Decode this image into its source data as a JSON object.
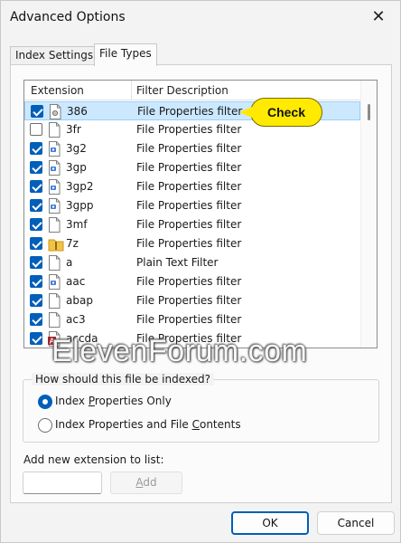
{
  "window": {
    "title": "Advanced Options"
  },
  "tabs": [
    {
      "label": "Index Settings",
      "selected": false
    },
    {
      "label": "File Types",
      "selected": true
    }
  ],
  "list": {
    "columns": [
      "Extension",
      "Filter Description"
    ],
    "rows": [
      {
        "ext": "386",
        "desc": "File Properties filter",
        "checked": true,
        "icon": "system-file-icon",
        "selected": true
      },
      {
        "ext": "3fr",
        "desc": "File Properties filter",
        "checked": false,
        "icon": "blank-file-icon"
      },
      {
        "ext": "3g2",
        "desc": "File Properties filter",
        "checked": true,
        "icon": "media-file-icon"
      },
      {
        "ext": "3gp",
        "desc": "File Properties filter",
        "checked": true,
        "icon": "media-file-icon"
      },
      {
        "ext": "3gp2",
        "desc": "File Properties filter",
        "checked": true,
        "icon": "media-file-icon"
      },
      {
        "ext": "3gpp",
        "desc": "File Properties filter",
        "checked": true,
        "icon": "media-file-icon"
      },
      {
        "ext": "3mf",
        "desc": "File Properties filter",
        "checked": true,
        "icon": "blank-file-icon"
      },
      {
        "ext": "7z",
        "desc": "File Properties filter",
        "checked": true,
        "icon": "folder-zip-icon"
      },
      {
        "ext": "a",
        "desc": "Plain Text Filter",
        "checked": true,
        "icon": "blank-file-icon"
      },
      {
        "ext": "aac",
        "desc": "File Properties filter",
        "checked": true,
        "icon": "media-file-icon"
      },
      {
        "ext": "abap",
        "desc": "File Properties filter",
        "checked": true,
        "icon": "blank-file-icon"
      },
      {
        "ext": "ac3",
        "desc": "File Properties filter",
        "checked": true,
        "icon": "blank-file-icon"
      },
      {
        "ext": "accda",
        "desc": "File Properties filter",
        "checked": true,
        "icon": "access-file-icon"
      }
    ]
  },
  "callout": {
    "text": "Check"
  },
  "watermark": {
    "text": "ElevenForum.com"
  },
  "index_group": {
    "label": "How should this file be indexed?",
    "options": [
      {
        "label": "Index Properties Only",
        "selected": true
      },
      {
        "label": "Index Properties and File Contents",
        "selected": false
      }
    ]
  },
  "add_extension": {
    "label": "Add new extension to list:",
    "value": "",
    "button": "Add"
  },
  "buttons": {
    "ok": "OK",
    "cancel": "Cancel"
  },
  "colors": {
    "accent": "#005fb8",
    "selection": "#cce8ff",
    "callout": "#ffea00"
  }
}
